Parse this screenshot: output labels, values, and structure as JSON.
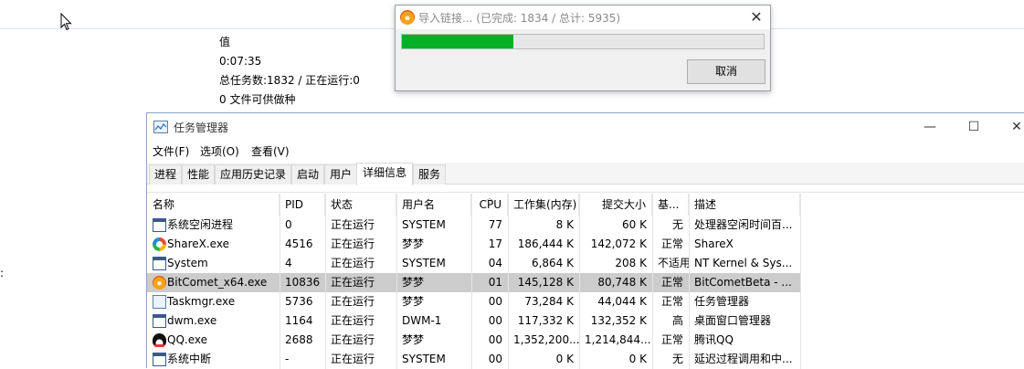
{
  "background": {
    "info_lines": [
      "值",
      "0:07:35",
      "总任务数:1832 / 正在运行:0",
      "0 文件可供做种"
    ],
    "colon": ":"
  },
  "import_dialog": {
    "title": "导入链接... (已完成: 1834 / 总计: 5935)",
    "completed": 1834,
    "total": 5935,
    "progress_fraction": 0.309,
    "cancel_label": "取消",
    "accent_color": "#06b025"
  },
  "task_manager": {
    "title": "任务管理器",
    "menu": [
      "文件(F)",
      "选项(O)",
      "查看(V)"
    ],
    "tabs": [
      "进程",
      "性能",
      "应用历史记录",
      "启动",
      "用户",
      "详细信息",
      "服务"
    ],
    "active_tab": "详细信息",
    "columns": [
      "名称",
      "PID",
      "状态",
      "用户名",
      "CPU",
      "工作集(内存)",
      "提交大小",
      "基...",
      "描述"
    ],
    "rows": [
      {
        "icon": "window-icon",
        "name": "系统空闲进程",
        "pid": "0",
        "status": "正在运行",
        "user": "SYSTEM",
        "cpu": "77",
        "ws": "8 K",
        "commit": "60 K",
        "base": "无",
        "desc": "处理器空闲时间百..."
      },
      {
        "icon": "sharex-icon",
        "name": "ShareX.exe",
        "pid": "4516",
        "status": "正在运行",
        "user": "梦梦",
        "cpu": "17",
        "ws": "186,444 K",
        "commit": "142,072 K",
        "base": "正常",
        "desc": "ShareX"
      },
      {
        "icon": "window-icon",
        "name": "System",
        "pid": "4",
        "status": "正在运行",
        "user": "SYSTEM",
        "cpu": "04",
        "ws": "6,864 K",
        "commit": "208 K",
        "base": "不适用",
        "desc": "NT Kernel & Sys..."
      },
      {
        "icon": "bitcomet-icon",
        "name": "BitComet_x64.exe",
        "pid": "10836",
        "status": "正在运行",
        "user": "梦梦",
        "cpu": "01",
        "ws": "145,128 K",
        "commit": "80,748 K",
        "base": "正常",
        "desc": "BitCometBeta - ..."
      },
      {
        "icon": "taskmgr-icon",
        "name": "Taskmgr.exe",
        "pid": "5736",
        "status": "正在运行",
        "user": "梦梦",
        "cpu": "00",
        "ws": "73,284 K",
        "commit": "44,044 K",
        "base": "正常",
        "desc": "任务管理器"
      },
      {
        "icon": "window-icon",
        "name": "dwm.exe",
        "pid": "1164",
        "status": "正在运行",
        "user": "DWM-1",
        "cpu": "00",
        "ws": "117,332 K",
        "commit": "132,352 K",
        "base": "高",
        "desc": "桌面窗口管理器"
      },
      {
        "icon": "qq-icon",
        "name": "QQ.exe",
        "pid": "2688",
        "status": "正在运行",
        "user": "梦梦",
        "cpu": "00",
        "ws": "1,352,200...",
        "commit": "1,214,844...",
        "base": "正常",
        "desc": "腾讯QQ"
      },
      {
        "icon": "window-icon",
        "name": "系统中断",
        "pid": "-",
        "status": "正在运行",
        "user": "SYSTEM",
        "cpu": "00",
        "ws": "0 K",
        "commit": "0 K",
        "base": "无",
        "desc": "延迟过程调用和中..."
      }
    ],
    "selected_row": 3
  }
}
